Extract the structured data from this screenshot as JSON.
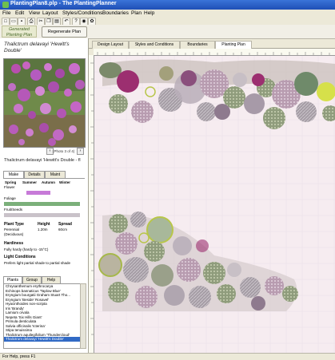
{
  "window": {
    "title": "PlantingPlan8.plp - The PlantingPlanner"
  },
  "menu": [
    "File",
    "Edit",
    "View",
    "Layout",
    "Styles/Conditions",
    "Boundaries",
    "Plan",
    "Help"
  ],
  "toolbar": {
    "icons": [
      "new-icon",
      "open-icon",
      "save-icon",
      "print-icon",
      "cut-icon",
      "copy-icon",
      "paste-icon",
      "undo-icon",
      "help-icon",
      "globe-icon",
      "plant-icon"
    ]
  },
  "generated_plan": {
    "label": "Generated Planting Plan",
    "regenerate_label": "Regenerate Plan"
  },
  "plant": {
    "title": "Thalictrum delavayi 'Hewitt's Double'",
    "photo_counter": "(Photo 3 of 4)",
    "caption": "Thalictrum delavayi 'Hewitt's Double - fl",
    "tabs": [
      "Make",
      "Details",
      "Maint"
    ],
    "seasons": [
      "Spring",
      "Summer",
      "Autumn",
      "Winter"
    ],
    "rows": [
      "Flower",
      "Foliage",
      "Fruit/Seeds"
    ],
    "colors": {
      "flower": "#c77ad8",
      "foliage": "#7bb07a",
      "fruit": "#c9c2c9"
    },
    "props_headers": [
      "Plant Type",
      "Height",
      "Spread"
    ],
    "props_values": [
      "Perennial",
      "1.20m",
      "60cm"
    ],
    "props_sub": "(Deciduous)",
    "hardiness_label": "Hardiness",
    "hardiness_value": "Fully hardy (hardy to -15°C)",
    "light_label": "Light Conditions",
    "light_value": "Prefers light partial shade to partial shade"
  },
  "bottom_tabs": [
    "Plants",
    "Group",
    "Help"
  ],
  "plant_list": [
    "Chrysanthemum erythrocarya",
    "Echinops bannaticus 'Taplow Blue'",
    "Eryngium bourgatii Graham Stuart Tho...",
    "Eryngium 'Beside' Rosavel'",
    "Hyacinthoides non-scripta",
    "Iris 'Brandy' ",
    "Lamium orvala",
    "Nepeta 'Six Hills Giant'",
    "Primula denticulata",
    "Salvia officinalis 'Icterina'",
    "Stipa tenuissima",
    "Thalictrum aquilegifolium 'Thundercloud'",
    "Thalictrum delavayi 'Hewitt's Double'"
  ],
  "right_tabs": [
    "Design Layout",
    "Styles and Conditions",
    "Boundaries",
    "Planting Plan"
  ],
  "status": "For Help, press F1"
}
